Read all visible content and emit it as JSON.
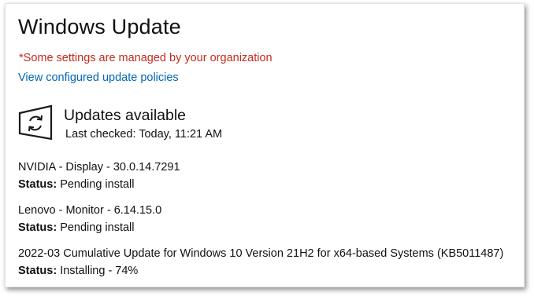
{
  "page": {
    "title": "Windows Update",
    "managed_notice": "*Some settings are managed by your organization",
    "policies_link": "View configured update policies"
  },
  "status": {
    "icon": "sync-icon",
    "heading": "Updates available",
    "last_checked": "Last checked: Today, 11:21 AM"
  },
  "updates": [
    {
      "name": "NVIDIA - Display - 30.0.14.7291",
      "status_label": "Status:",
      "status_value": "Pending install"
    },
    {
      "name": "Lenovo - Monitor - 6.14.15.0",
      "status_label": "Status:",
      "status_value": "Pending install"
    },
    {
      "name": "2022-03 Cumulative Update for Windows 10 Version 21H2 for x64-based Systems (KB5011487)",
      "status_label": "Status:",
      "status_value": "Installing - 74%"
    }
  ],
  "colors": {
    "warning_text": "#c42b1c",
    "link": "#0067b8"
  }
}
